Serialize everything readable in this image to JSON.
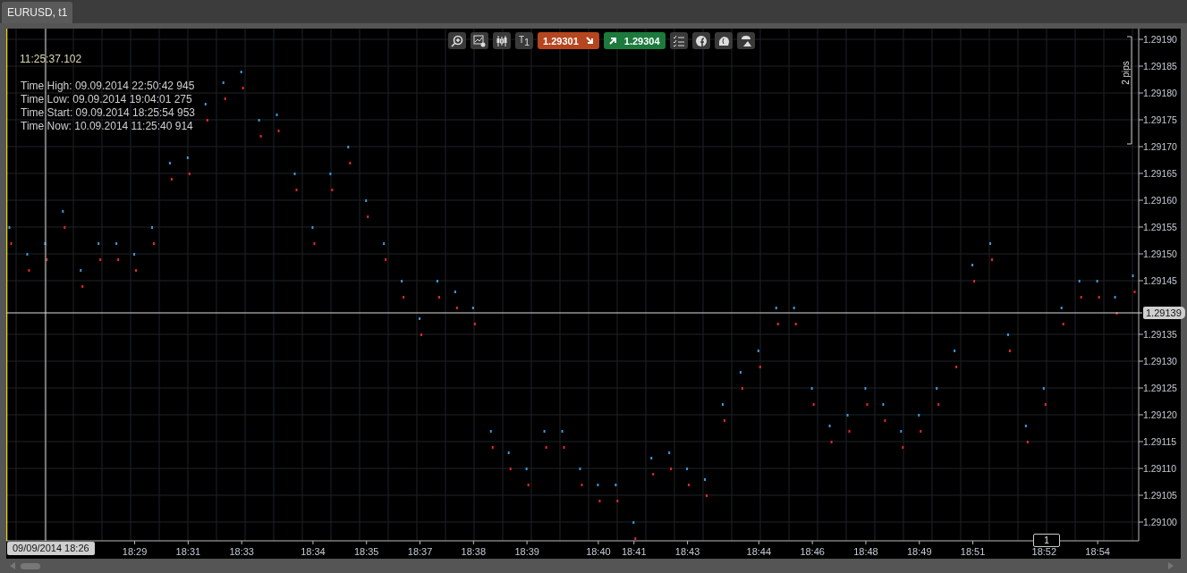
{
  "tab": {
    "label": "EURUSD, t1",
    "selected": true
  },
  "toolbar": {
    "timeframe": {
      "top": "T",
      "sub": "1"
    },
    "sell": {
      "price": "1.29301"
    },
    "buy": {
      "price": "1.29304"
    }
  },
  "clock": "11:25:37.102",
  "info_lines": [
    "Time High: 09.09.2014 22:50:42 945",
    "Time Low: 09.09.2014 19:04:01 275",
    "Time Start: 09.09.2014 18:25:54 953",
    "Time Now: 10.09.2014 11:25:40 914"
  ],
  "pip_ruler": {
    "label": "2 pips"
  },
  "crosshair": {
    "label": "09/09/2014 18:26"
  },
  "tick_counter": "1",
  "chart_data": {
    "type": "scatter",
    "ylim": [
      1.290965,
      1.29192
    ],
    "categories": [
      null,
      null,
      null,
      null,
      null,
      null,
      null,
      "18:29",
      null,
      null,
      "18:31",
      null,
      null,
      "18:33",
      null,
      null,
      null,
      "18:34",
      null,
      null,
      "18:35",
      null,
      null,
      "18:37",
      null,
      null,
      "18:38",
      null,
      null,
      "18:39",
      null,
      null,
      null,
      "18:40",
      null,
      "18:41",
      null,
      null,
      "18:43",
      null,
      null,
      null,
      "18:44",
      null,
      null,
      "18:46",
      null,
      null,
      "18:48",
      null,
      null,
      "18:49",
      null,
      null,
      "18:51",
      null,
      null,
      null,
      "18:52",
      null,
      null,
      "18:54",
      null,
      null
    ],
    "series": [
      {
        "color": "#3a9ad9",
        "values": [
          1.29155,
          1.2915,
          1.29152,
          1.29158,
          1.29147,
          1.29152,
          1.29152,
          1.2915,
          1.29155,
          1.29167,
          1.29168,
          1.29178,
          1.29182,
          1.29184,
          1.29175,
          1.29176,
          1.29165,
          1.29155,
          1.29165,
          1.2917,
          1.2916,
          1.29152,
          1.29145,
          1.29138,
          1.29145,
          1.29143,
          1.2914,
          1.29117,
          1.29113,
          1.2911,
          1.29117,
          1.29117,
          1.2911,
          1.29107,
          1.29107,
          1.291,
          1.29112,
          1.29113,
          1.2911,
          1.29108,
          1.29122,
          1.29128,
          1.29132,
          1.2914,
          1.2914,
          1.29125,
          1.29118,
          1.2912,
          1.29125,
          1.29122,
          1.29117,
          1.2912,
          1.29125,
          1.29132,
          1.29148,
          1.29152,
          1.29135,
          1.29118,
          1.29125,
          1.2914,
          1.29145,
          1.29145,
          1.29142,
          1.29146
        ]
      },
      {
        "color": "#e8262a",
        "values": [
          1.29152,
          1.29147,
          1.29149,
          1.29155,
          1.29144,
          1.29149,
          1.29149,
          1.29147,
          1.29152,
          1.29164,
          1.29165,
          1.29175,
          1.29179,
          1.29181,
          1.29172,
          1.29173,
          1.29162,
          1.29152,
          1.29162,
          1.29167,
          1.29157,
          1.29149,
          1.29142,
          1.29135,
          1.29142,
          1.2914,
          1.29137,
          1.29114,
          1.2911,
          1.29107,
          1.29114,
          1.29114,
          1.29107,
          1.29104,
          1.29104,
          1.29097,
          1.29109,
          1.2911,
          1.29107,
          1.29105,
          1.29119,
          1.29125,
          1.29129,
          1.29137,
          1.29137,
          1.29122,
          1.29115,
          1.29117,
          1.29122,
          1.29119,
          1.29114,
          1.29117,
          1.29122,
          1.29129,
          1.29145,
          1.29149,
          1.29132,
          1.29115,
          1.29122,
          1.29137,
          1.29142,
          1.29142,
          1.29139,
          1.29143
        ]
      }
    ],
    "yticks": [
      {
        "value": 1.2919,
        "label": "1.29190"
      },
      {
        "value": 1.29185,
        "label": "1.29185"
      },
      {
        "value": 1.2918,
        "label": "1.29180"
      },
      {
        "value": 1.29175,
        "label": "1.29175"
      },
      {
        "value": 1.2917,
        "label": "1.29170"
      },
      {
        "value": 1.29165,
        "label": "1.29165"
      },
      {
        "value": 1.2916,
        "label": "1.29160"
      },
      {
        "value": 1.29155,
        "label": "1.29155"
      },
      {
        "value": 1.2915,
        "label": "1.29150"
      },
      {
        "value": 1.29145,
        "label": "1.29145"
      },
      {
        "value": 1.29135,
        "label": "1.29135"
      },
      {
        "value": 1.2913,
        "label": "1.29130"
      },
      {
        "value": 1.29125,
        "label": "1.29125"
      },
      {
        "value": 1.2912,
        "label": "1.29120"
      },
      {
        "value": 1.29115,
        "label": "1.29115"
      },
      {
        "value": 1.2911,
        "label": "1.29110"
      },
      {
        "value": 1.29105,
        "label": "1.29105"
      },
      {
        "value": 1.291,
        "label": "1.29100"
      }
    ],
    "grid": true,
    "ref_lines": [
      {
        "axis": "y",
        "value": 1.29139,
        "label": "1.29139"
      }
    ]
  }
}
